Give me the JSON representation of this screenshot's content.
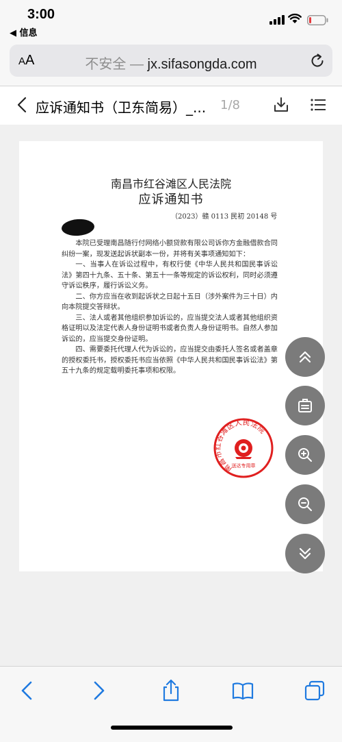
{
  "status_bar": {
    "time": "3:00",
    "back_app": "◀ 信息"
  },
  "url_bar": {
    "text_size": "AA",
    "insecure_label": "不安全",
    "separator": " — ",
    "domain": "jx.sifasongda.com"
  },
  "doc_header": {
    "title": "应诉通知书（卫东简易）_...",
    "page": "1/8"
  },
  "document": {
    "court_name": "南昌市红谷滩区人民法院",
    "doc_title": "应诉通知书",
    "case_number": "（2023）赣 0113 民初 20148 号",
    "paragraphs": [
      "本院已受理南昌随行付网络小额贷款有限公司诉你方金融借款合同纠纷一案，现发送起诉状副本一份，并将有关事项通知如下：",
      "一、当事人在诉讼过程中，有权行使《中华人民共和国民事诉讼法》第四十九条、五十条、第五十一条等规定的诉讼权利，同时必须遵守诉讼秩序，履行诉讼义务。",
      "二、你方应当在收到起诉状之日起十五日（涉外案件为三十日）内向本院提交答辩状。",
      "三、法人或者其他组织参加诉讼的，应当提交法人或者其他组织资格证明以及法定代表人身份证明书或者负责人身份证明书。自然人参加诉讼的，应当提交身份证明。",
      "四、需要委托代理人代为诉讼的，应当提交由委托人签名或者盖章的授权委托书，授权委托书应当依照《中华人民共和国民事诉讼法》第五十九条的规定载明委托事项和权限。"
    ],
    "seal": {
      "ring_text": "南昌市红谷滩区人民法院",
      "band_text": "送达专用章",
      "color": "#e02020"
    }
  },
  "floating_buttons": [
    "double-chevron-up-icon",
    "clipboard-icon",
    "zoom-in-icon",
    "zoom-out-icon",
    "double-chevron-down-icon"
  ],
  "toolbar": [
    "back-icon",
    "forward-icon",
    "share-icon",
    "bookmarks-icon",
    "tabs-icon"
  ],
  "colors": {
    "accent": "#1f7ae0",
    "fab": "#7b7b7b",
    "battery_low": "#e5383b"
  }
}
